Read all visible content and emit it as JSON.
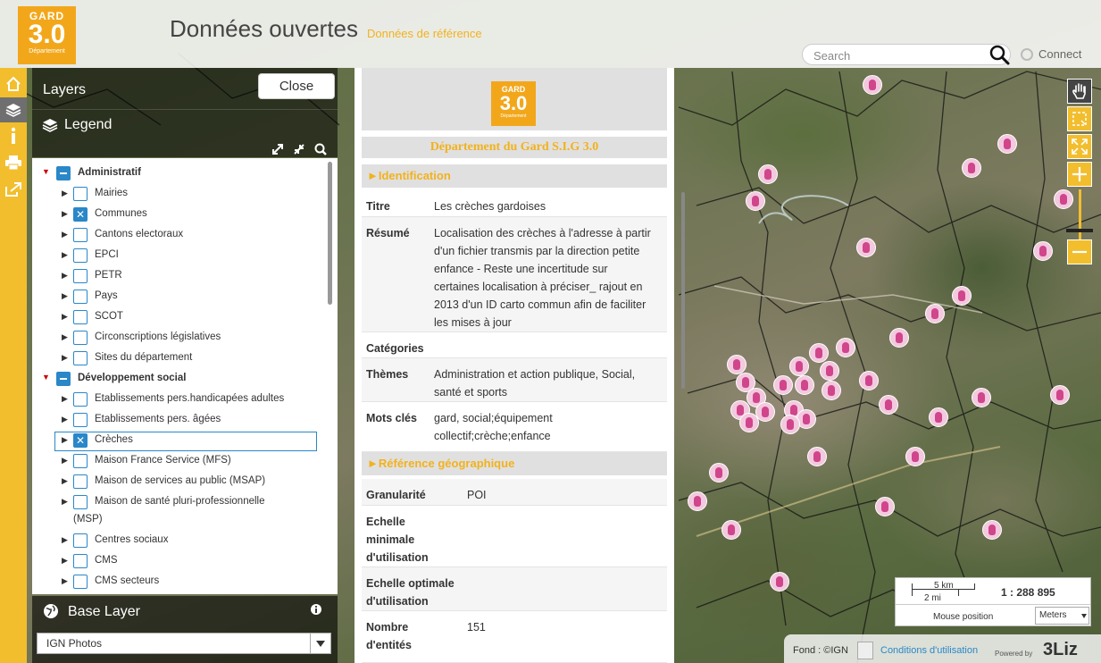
{
  "header": {
    "logo": {
      "line1": "GARD",
      "line2": "3.0",
      "line3": "Département"
    },
    "title": "Données ouvertes",
    "subtitle": "Données de référence",
    "search_placeholder": "Search",
    "connect_label": "Connect"
  },
  "menubar": {
    "items": [
      {
        "name": "home",
        "icon": "home-icon"
      },
      {
        "name": "layers",
        "icon": "layers-icon",
        "active": true
      },
      {
        "name": "information",
        "icon": "info-icon"
      },
      {
        "name": "print",
        "icon": "print-icon"
      },
      {
        "name": "share",
        "icon": "share-icon"
      }
    ]
  },
  "dock": {
    "title": "Layers",
    "close_label": "Close",
    "legend_label": "Legend",
    "tree": [
      {
        "label": "Administratif",
        "group": true,
        "state": "partial",
        "expanded": true
      },
      {
        "label": "Mairies",
        "state": "unchecked"
      },
      {
        "label": "Communes",
        "state": "checked"
      },
      {
        "label": "Cantons electoraux",
        "state": "unchecked"
      },
      {
        "label": "EPCI",
        "state": "unchecked"
      },
      {
        "label": "PETR",
        "state": "unchecked"
      },
      {
        "label": "Pays",
        "state": "unchecked"
      },
      {
        "label": "SCOT",
        "state": "unchecked"
      },
      {
        "label": "Circonscriptions législatives",
        "state": "unchecked"
      },
      {
        "label": "Sites du département",
        "state": "unchecked"
      },
      {
        "label": "Développement social",
        "group": true,
        "state": "partial",
        "expanded": true
      },
      {
        "label": "Etablissements pers.handicapées adultes",
        "state": "unchecked"
      },
      {
        "label": "Etablissements pers. âgées",
        "state": "unchecked"
      },
      {
        "label": "Crèches",
        "state": "checked",
        "selected": true
      },
      {
        "label": "Maison France Service (MFS)",
        "state": "unchecked"
      },
      {
        "label": "Maison de services au public (MSAP)",
        "state": "unchecked"
      },
      {
        "label": "Maison de santé pluri-professionnelle",
        "label2": "(MSP)",
        "state": "unchecked"
      },
      {
        "label": "Centres sociaux",
        "state": "unchecked"
      },
      {
        "label": "CMS",
        "state": "unchecked"
      },
      {
        "label": "CMS secteurs",
        "state": "unchecked"
      }
    ],
    "baselayer_label": "Base Layer",
    "baselayer_value": "IGN Photos"
  },
  "metadata": {
    "logo": {
      "line1": "GARD",
      "line2": "3.0",
      "line3": "Département"
    },
    "organization": "Département du Gard S.I.G 3.0",
    "identification_header": "►Identification",
    "rows": [
      {
        "key": "Titre",
        "value": "Les crèches gardoises"
      },
      {
        "key": "Résumé",
        "value_lines": [
          "Localisation des crèches à l'adresse à partir",
          "d'un fichier transmis par la direction petite",
          "enfance - Reste une incertitude sur",
          "certaines localisation à préciser_ rajout en",
          "2013 d'un ID carto commun afin de faciliter",
          "les mises à jour"
        ]
      },
      {
        "key": "Catégories",
        "value": ""
      },
      {
        "key": "Thèmes",
        "value_lines": [
          "Administration et action publique, Social,",
          "santé et sports"
        ]
      },
      {
        "key": "Mots clés",
        "value_lines": [
          "gard, social;équipement",
          "collectif;crèche;enfance"
        ]
      }
    ],
    "geo_header": "►Référence géographique",
    "geo_rows": [
      {
        "key_lines": [
          "Granularité"
        ],
        "value": "POI"
      },
      {
        "key_lines": [
          "Echelle",
          "minimale",
          "d'utilisation"
        ],
        "value": ""
      },
      {
        "key_lines": [
          "Echelle optimale",
          "d'utilisation"
        ],
        "value": ""
      },
      {
        "key_lines": [
          "Nombre",
          "d'entités"
        ],
        "value": "151"
      }
    ]
  },
  "map": {
    "scale_km": "5 km",
    "scale_mi": "2 mi",
    "scale_ratio": "1 : 288 895",
    "mouse_position_label": "Mouse position",
    "units_value": "Meters",
    "attribution_fond": "Fond : ©IGN",
    "conditions_label": "Conditions d'utilisation",
    "powered_by": "Powered by",
    "brand": "3Liz",
    "marker_color": "#d0458b"
  },
  "colors": {
    "accent": "#f2be2e",
    "link": "#2a87c8"
  }
}
